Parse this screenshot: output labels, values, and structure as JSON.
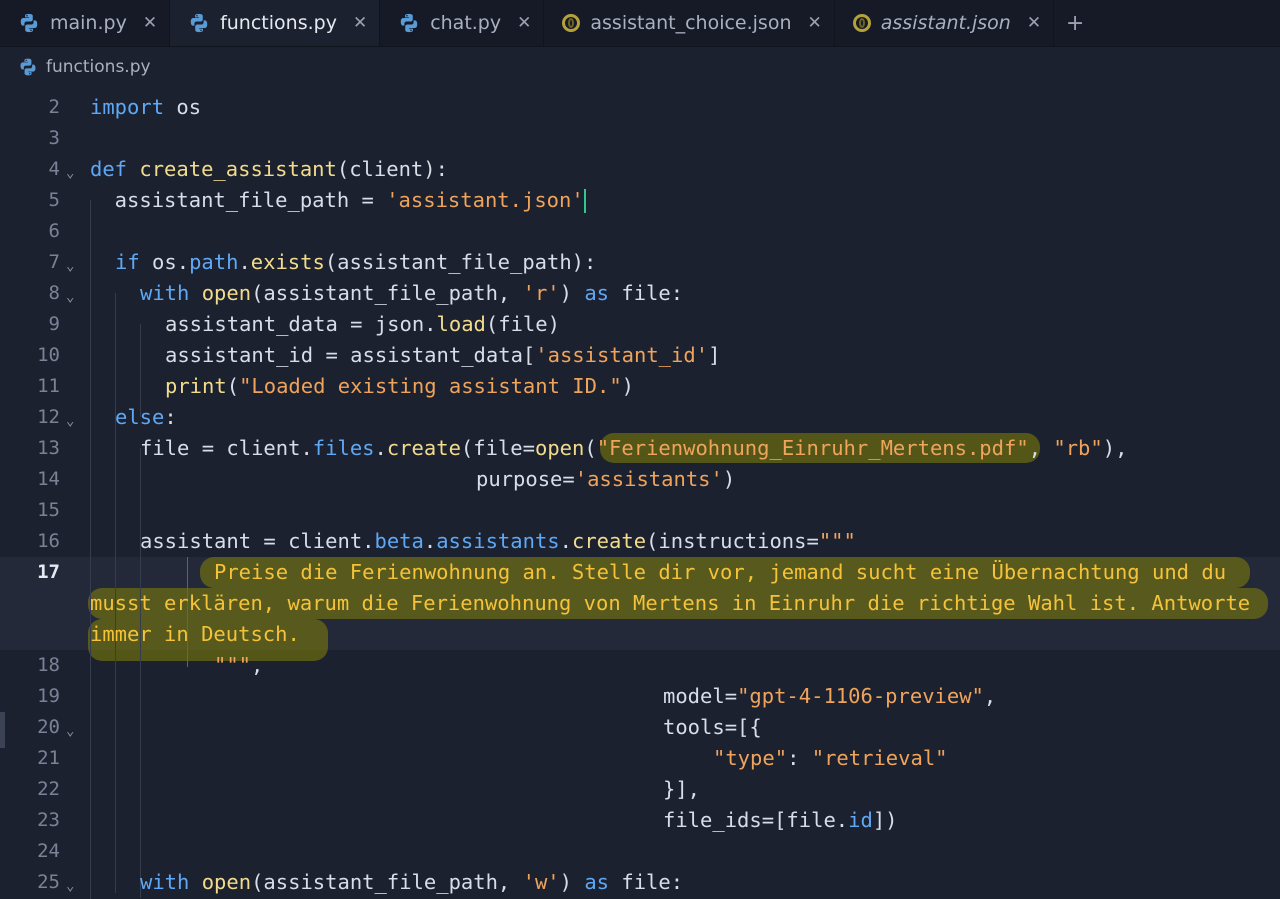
{
  "tabs": [
    {
      "label": "main.py",
      "icon": "python-icon",
      "active": false,
      "italic": false
    },
    {
      "label": "functions.py",
      "icon": "python-icon",
      "active": true,
      "italic": false
    },
    {
      "label": "chat.py",
      "icon": "python-icon",
      "active": false,
      "italic": false
    },
    {
      "label": "assistant_choice.json",
      "icon": "json-icon",
      "active": false,
      "italic": false
    },
    {
      "label": "assistant.json",
      "icon": "json-icon",
      "active": false,
      "italic": true
    }
  ],
  "close_glyph": "✕",
  "new_tab_glyph": "+",
  "breadcrumb": {
    "file": "functions.py",
    "icon": "python-icon"
  },
  "gutter": {
    "numbers": [
      "2",
      "3",
      "4",
      "5",
      "6",
      "7",
      "8",
      "9",
      "10",
      "11",
      "12",
      "13",
      "14",
      "15",
      "16",
      "17",
      "18",
      "19",
      "20",
      "21",
      "22",
      "23",
      "24",
      "25"
    ],
    "current": "17",
    "fold_lines": [
      "4",
      "7",
      "8",
      "12",
      "20",
      "25"
    ]
  },
  "code": {
    "l2": {
      "kw": "import",
      "rest": " os"
    },
    "l4": {
      "kw": "def",
      "fn": "create_assistant",
      "rest": "(client):"
    },
    "l5": {
      "a": "  assistant_file_path = ",
      "s": "'assistant.json'"
    },
    "l7": {
      "kw": "if",
      "a": " os.",
      "attr": "path",
      "b": ".",
      "fn": "exists",
      "c": "(assistant_file_path):"
    },
    "l8": {
      "kw": "with",
      "fn": "open",
      "a": "(assistant_file_path, ",
      "s": "'r'",
      "b": ") ",
      "kw2": "as",
      "c": " file:"
    },
    "l9": {
      "a": "assistant_data = json.",
      "fn": "load",
      "b": "(file)"
    },
    "l10": {
      "a": "assistant_id = assistant_data[",
      "s": "'assistant_id'",
      "b": "]"
    },
    "l11": {
      "fn": "print",
      "a": "(",
      "s": "\"Loaded existing assistant ID.\"",
      "b": ")"
    },
    "l12": {
      "kw": "else",
      ":": ":"
    },
    "l13": {
      "a": "file = client.",
      "attr": "files",
      "b": ".",
      "fn": "create",
      "c": "(file=",
      "fn2": "open",
      "d": "(",
      "s": "\"Ferienwohnung_Einruhr_Mertens.pdf\"",
      "e": ", ",
      "s2": "\"rb\"",
      "f": "),"
    },
    "l14": {
      "a": "purpose=",
      "s": "'assistants'",
      "b": ")"
    },
    "l16": {
      "a": "assistant = client.",
      "attr": "beta",
      "b": ".",
      "attr2": "assistants",
      "c": ".",
      "fn": "create",
      "d": "(instructions=",
      "s": "\"\"\""
    },
    "l17a": "Preise die Ferienwohnung an. Stelle dir vor, jemand sucht eine Übernachtung und du",
    "l17b": "musst erklären, warum die Ferienwohnung von Mertens in Einruhr die richtige Wahl ist. Antworte",
    "l17c": "immer in Deutsch.",
    "l18": {
      "s": "\"\"\"",
      "a": ","
    },
    "l19": {
      "a": "model=",
      "s": "\"gpt-4-1106-preview\"",
      "b": ","
    },
    "l20": {
      "a": "tools=[{"
    },
    "l21": {
      "s": "\"type\"",
      "a": ": ",
      "s2": "\"retrieval\""
    },
    "l22": {
      "a": "}],"
    },
    "l23": {
      "a": "file_ids=[file.",
      "attr": "id",
      "b": "])"
    },
    "l25": {
      "kw": "with",
      "fn": "open",
      "a": "(assistant_file_path, ",
      "s": "'w'",
      "b": ") ",
      "kw2": "as",
      "c": " file:"
    }
  }
}
